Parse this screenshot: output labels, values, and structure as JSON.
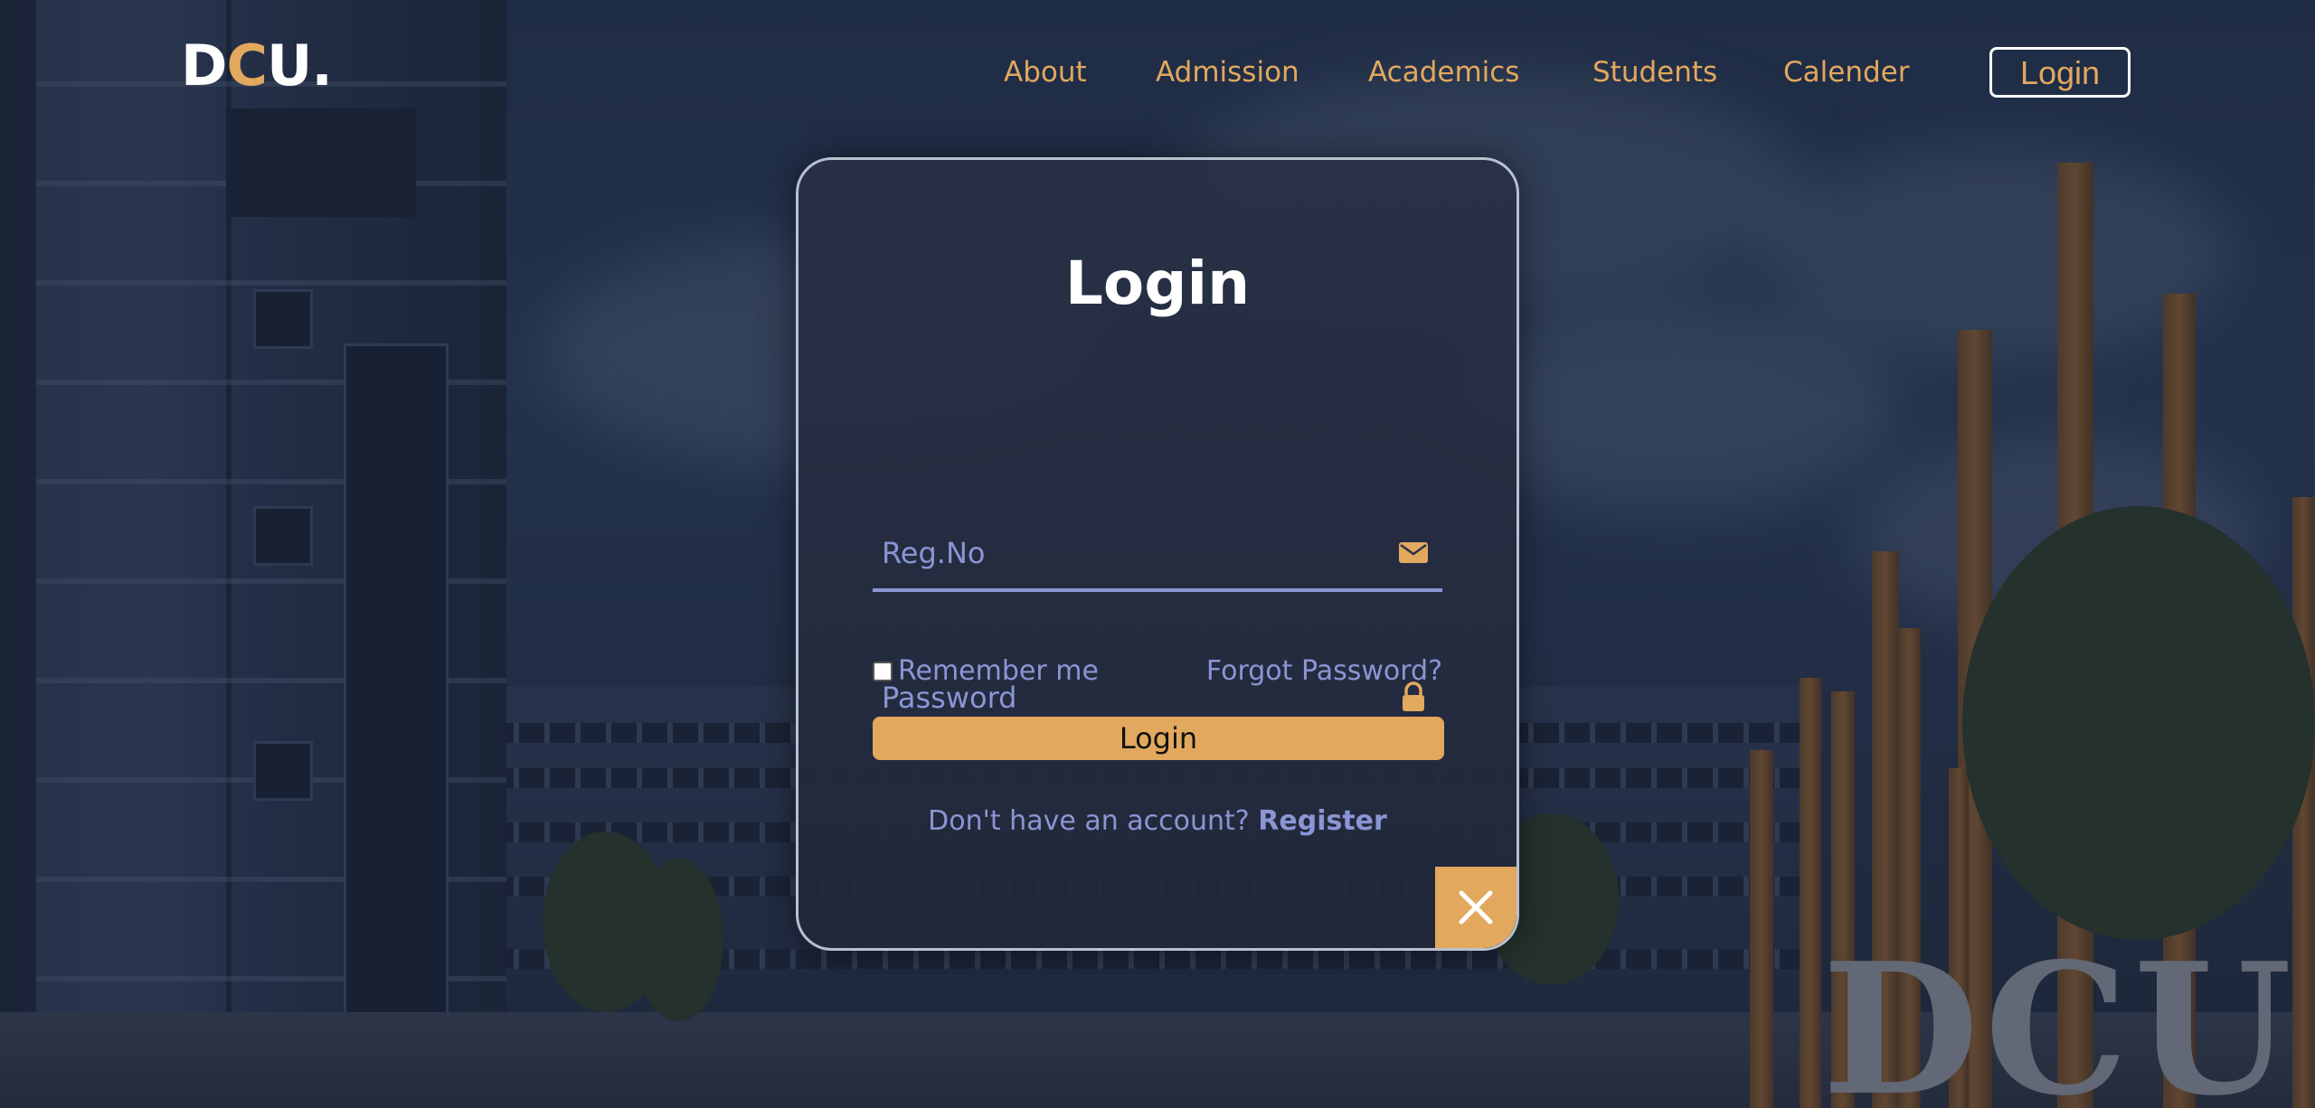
{
  "header": {
    "logo": {
      "part1": "D",
      "part2": "C",
      "part3": "U",
      "dot": "."
    },
    "nav": [
      {
        "label": "About"
      },
      {
        "label": "Admission"
      },
      {
        "label": "Academics"
      },
      {
        "label": "Students"
      },
      {
        "label": "Calender"
      }
    ],
    "login_label": "Login"
  },
  "background": {
    "sign_text": "DCU"
  },
  "login_card": {
    "title": "Login",
    "regno_placeholder": "Reg.No",
    "password_placeholder": "Password",
    "remember_label": "Remember me",
    "remember_checked": false,
    "forgot_label": "Forgot Password?",
    "submit_label": "Login",
    "no_account_text": "Don't have an account?",
    "register_label": "Register",
    "icons": {
      "regno": "envelope-icon",
      "password": "lock-icon",
      "close": "close-icon"
    }
  },
  "colors": {
    "accent": "#e2a85e",
    "field_text": "#8a96d4",
    "card_border": "#b9c0cf"
  }
}
